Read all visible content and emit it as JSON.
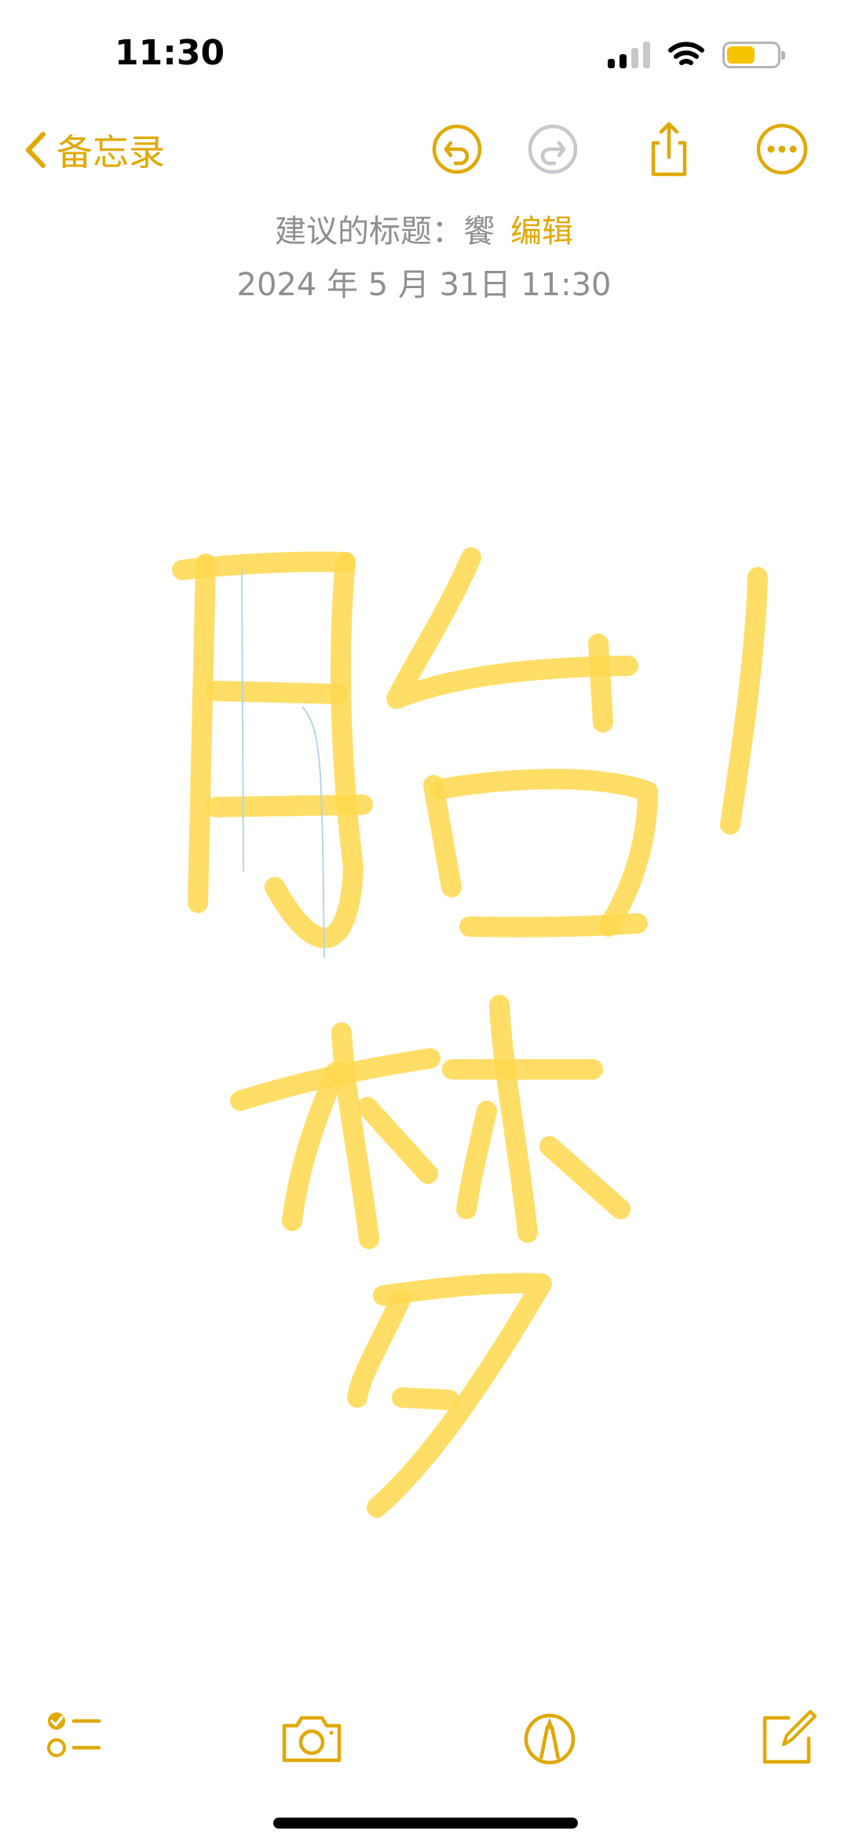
{
  "status_bar": {
    "time": "11:30",
    "signal_icon": "cellular-signal-icon",
    "wifi_icon": "wifi-icon",
    "battery_level": 0.55,
    "battery_color": "#f5c400"
  },
  "nav": {
    "back_label": "备忘录",
    "accent_color": "#e0a800",
    "icons": [
      "chevron-left-icon",
      "undo-icon",
      "redo-icon",
      "share-icon",
      "more-icon"
    ]
  },
  "note": {
    "suggested_title_label": "建议的标题：",
    "suggested_title_value": "饗",
    "edit_label": "编辑",
    "date": "2024 年 5 月 31日 11:30",
    "drawing_color": "#ffd84d"
  },
  "toolbar": {
    "icons": [
      "checklist-icon",
      "camera-icon",
      "markup-pen-icon",
      "compose-icon"
    ]
  }
}
